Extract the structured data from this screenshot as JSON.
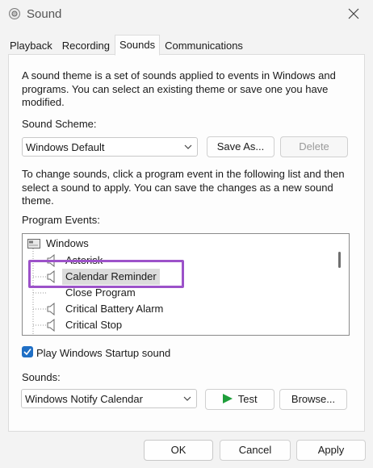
{
  "window": {
    "title": "Sound"
  },
  "tabs": [
    {
      "label": "Playback"
    },
    {
      "label": "Recording"
    },
    {
      "label": "Sounds",
      "active": true
    },
    {
      "label": "Communications"
    }
  ],
  "sounds_tab": {
    "intro": "A sound theme is a set of sounds applied to events in Windows and programs.  You can select an existing theme or save one you have modified.",
    "scheme_label": "Sound Scheme:",
    "scheme_value": "Windows Default",
    "save_as_label": "Save As...",
    "delete_label": "Delete",
    "instructions": "To change sounds, click a program event in the following list and then select a sound to apply.  You can save the changes as a new sound theme.",
    "program_events_label": "Program Events:",
    "events_root": "Windows",
    "events": [
      {
        "label": "Asterisk"
      },
      {
        "label": "Calendar Reminder",
        "selected": true
      },
      {
        "label": "Close Program"
      },
      {
        "label": "Critical Battery Alarm"
      },
      {
        "label": "Critical Stop"
      }
    ],
    "startup_checkbox_label": "Play Windows Startup sound",
    "startup_checked": true,
    "sounds_label": "Sounds:",
    "sound_value": "Windows Notify Calendar",
    "test_label": "Test",
    "browse_label": "Browse..."
  },
  "footer": {
    "ok_label": "OK",
    "cancel_label": "Cancel",
    "apply_label": "Apply"
  },
  "colors": {
    "accent": "#1f6fc5",
    "highlight_box": "#9c52c9",
    "test_icon": "#1e9e3a"
  },
  "icons": {
    "app": "speaker-icon",
    "close": "close-icon",
    "dropdown": "chevron-down-icon",
    "event": "speaker-icon",
    "root": "windows-folder-icon",
    "test": "play-icon",
    "checkbox": "checkmark-icon"
  }
}
